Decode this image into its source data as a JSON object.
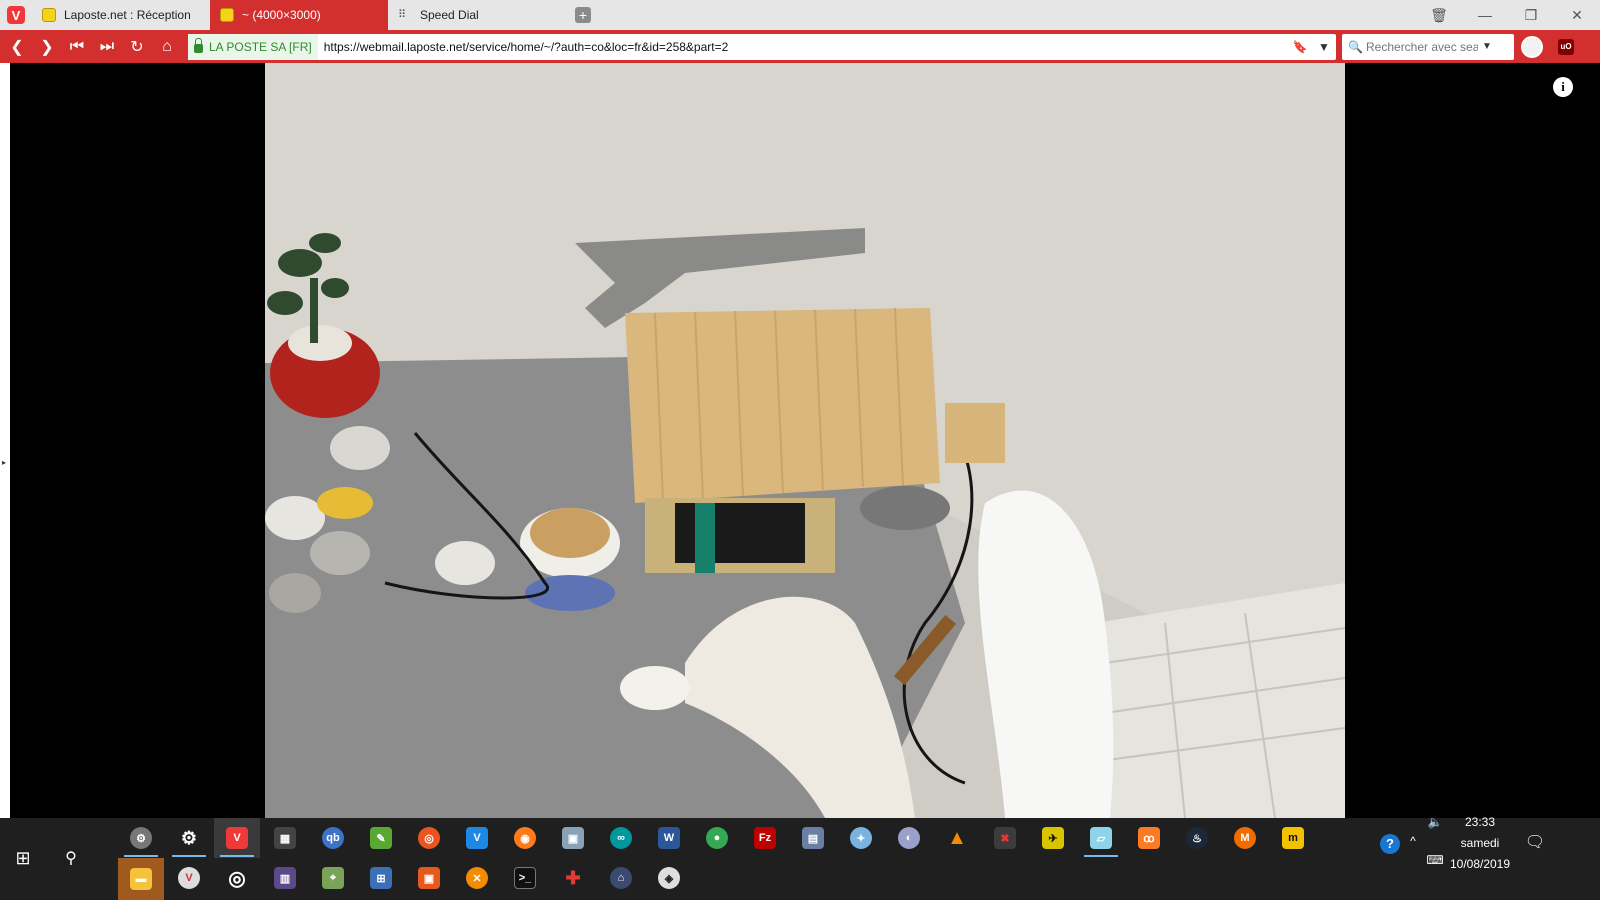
{
  "tabs": [
    {
      "label": "Laposte.net : Réception",
      "active": false
    },
    {
      "label": "~ (4000×3000)",
      "active": true
    },
    {
      "label": "Speed Dial",
      "active": false
    }
  ],
  "address": {
    "cert_label": "LA POSTE SA [FR]",
    "url": "https://webmail.laposte.net/service/home/~/?auth=co&loc=fr&id=258&part=2"
  },
  "search": {
    "placeholder": "Rechercher avec sea"
  },
  "viewer": {
    "image_dimensions": "(4000×3000)"
  },
  "taskbar": {
    "clock_time": "23:33",
    "clock_day": "samedi",
    "clock_date": "10/08/2019",
    "row1": [
      "settings-gear",
      "gear",
      "vivaldi",
      "calculator",
      "qbittorrent",
      "notepad",
      "ubuntu",
      "vscode",
      "firefox",
      "photos",
      "arduino",
      "word",
      "chrome",
      "filezilla",
      "editor",
      "paint",
      "dvd",
      "vlc",
      "tool-x",
      "xplane",
      "notebook",
      "xampp",
      "steam",
      "cloud",
      "latex"
    ],
    "row2": [
      "explorer",
      "vivaldi-alt",
      "target",
      "books",
      "map",
      "network",
      "media",
      "x-game",
      "terminal",
      "gamepad",
      "launcher",
      "unity"
    ],
    "colors": {
      "accent": "#d32f2f",
      "taskbar": "#1f1f1f"
    }
  }
}
